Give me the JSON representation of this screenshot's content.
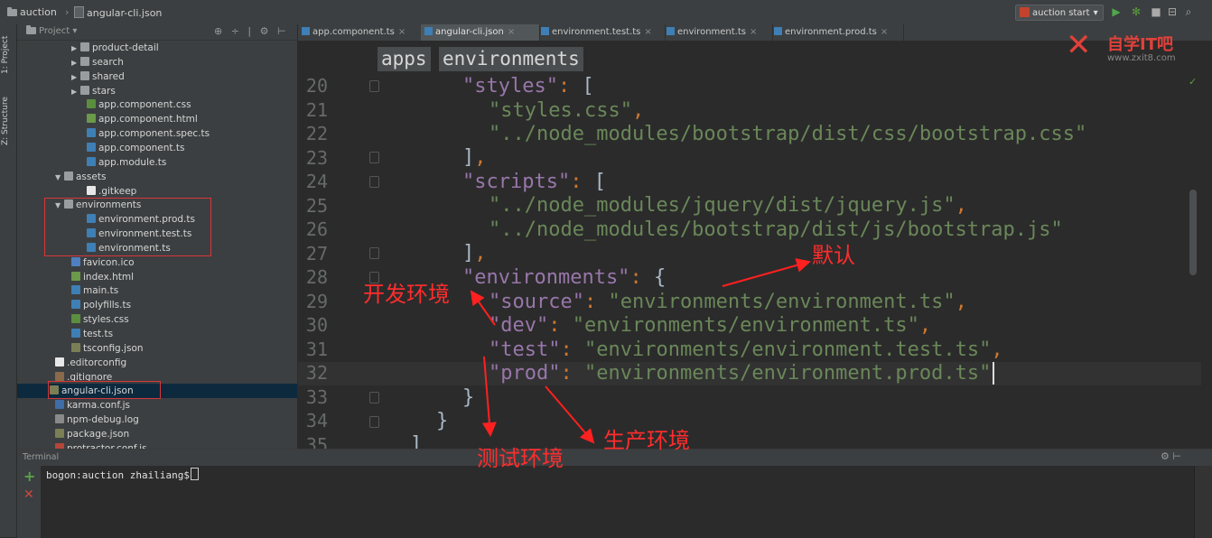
{
  "titlebar": {
    "project_name": "auction",
    "file_name": "angular-cli.json",
    "run_config": "auction start"
  },
  "toolstrip": {
    "project_tab": "1: Project",
    "structure_tab": "Z: Structure"
  },
  "project_panel": {
    "title": "Project",
    "tree": [
      {
        "label": "product-detail",
        "type": "folder"
      },
      {
        "label": "search",
        "type": "folder"
      },
      {
        "label": "shared",
        "type": "folder"
      },
      {
        "label": "stars",
        "type": "folder"
      },
      {
        "label": "app.component.css",
        "type": "css"
      },
      {
        "label": "app.component.html",
        "type": "html"
      },
      {
        "label": "app.component.spec.ts",
        "type": "ts"
      },
      {
        "label": "app.component.ts",
        "type": "ts"
      },
      {
        "label": "app.module.ts",
        "type": "ts"
      },
      {
        "label": "assets",
        "type": "folder"
      },
      {
        "label": ".gitkeep",
        "type": "file"
      },
      {
        "label": "environments",
        "type": "folder"
      },
      {
        "label": "environment.prod.ts",
        "type": "ts"
      },
      {
        "label": "environment.test.ts",
        "type": "ts"
      },
      {
        "label": "environment.ts",
        "type": "ts"
      },
      {
        "label": "favicon.ico",
        "type": "ico"
      },
      {
        "label": "index.html",
        "type": "html"
      },
      {
        "label": "main.ts",
        "type": "ts"
      },
      {
        "label": "polyfills.ts",
        "type": "ts"
      },
      {
        "label": "styles.css",
        "type": "css"
      },
      {
        "label": "test.ts",
        "type": "ts"
      },
      {
        "label": "tsconfig.json",
        "type": "json"
      },
      {
        "label": ".editorconfig",
        "type": "file"
      },
      {
        "label": ".gitignore",
        "type": "git"
      },
      {
        "label": "angular-cli.json",
        "type": "json"
      },
      {
        "label": "karma.conf.js",
        "type": "js"
      },
      {
        "label": "npm-debug.log",
        "type": "log"
      },
      {
        "label": "package.json",
        "type": "json"
      },
      {
        "label": "protractor.conf.js",
        "type": "red"
      }
    ]
  },
  "tabs": [
    {
      "label": "app.component.ts"
    },
    {
      "label": "angular-cli.json"
    },
    {
      "label": "environment.test.ts"
    },
    {
      "label": "environment.ts"
    },
    {
      "label": "environment.prod.ts"
    }
  ],
  "breadcrumbs": [
    "apps",
    "environments"
  ],
  "code": {
    "line_numbers": [
      "20",
      "21",
      "22",
      "23",
      "24",
      "25",
      "26",
      "27",
      "28",
      "29",
      "30",
      "31",
      "32",
      "33",
      "34",
      "35"
    ]
  },
  "watermark": {
    "name": "自学IT吧",
    "url": "www.zxit8.com"
  },
  "terminal": {
    "title": "Terminal",
    "prompt": "bogon:auction zhailiang$"
  },
  "annotations": {
    "default": "默认",
    "dev": "开发环境",
    "test": "测试环境",
    "prod": "生产环境"
  }
}
